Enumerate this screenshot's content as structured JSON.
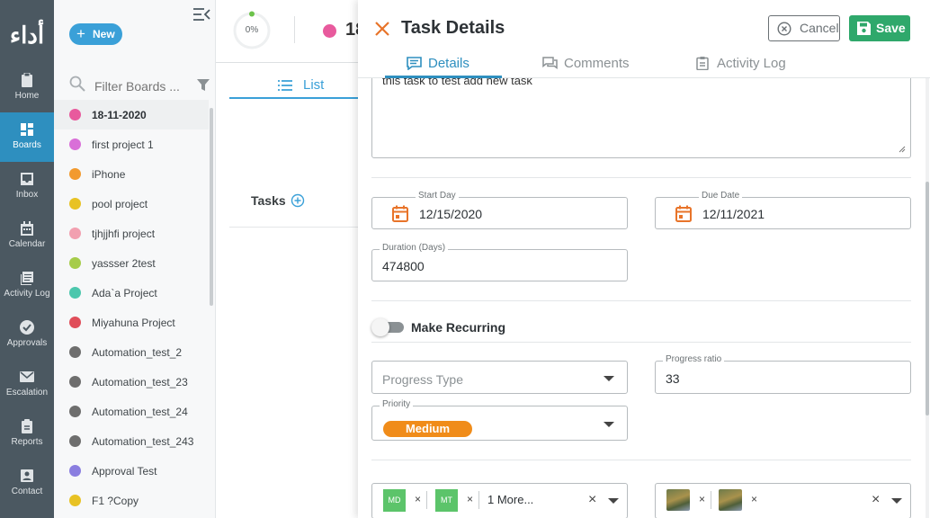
{
  "app": {
    "logo_text": "أداء"
  },
  "nav": {
    "items": [
      {
        "label": "Home",
        "icon": "clipboard-icon"
      },
      {
        "label": "Boards",
        "icon": "grid-icon"
      },
      {
        "label": "Inbox",
        "icon": "inbox-icon"
      },
      {
        "label": "Calendar",
        "icon": "calendar-icon"
      },
      {
        "label": "Activity Log",
        "icon": "log-icon"
      },
      {
        "label": "Approvals",
        "icon": "check-circle-icon"
      },
      {
        "label": "Escalation",
        "icon": "mail-icon"
      },
      {
        "label": "Reports",
        "icon": "report-icon"
      },
      {
        "label": "Contact",
        "icon": "contact-icon"
      }
    ],
    "active": "Boards"
  },
  "boards": {
    "new_label": "New",
    "filter_placeholder": "Filter Boards ...",
    "items": [
      {
        "name": "18-11-2020",
        "color": "#e85a9d"
      },
      {
        "name": "first project 1",
        "color": "#d96fd8"
      },
      {
        "name": "iPhone",
        "color": "#f29a2e"
      },
      {
        "name": "pool project",
        "color": "#e8c224"
      },
      {
        "name": "tjhjjhfi project",
        "color": "#f2a0b0"
      },
      {
        "name": "yassser 2test",
        "color": "#a6cc4a"
      },
      {
        "name": "Ada`a Project",
        "color": "#4cc7ad"
      },
      {
        "name": "Miyahuna Project",
        "color": "#e04e5a"
      },
      {
        "name": "Automation_test_2",
        "color": "#6e6e6e"
      },
      {
        "name": "Automation_test_23",
        "color": "#6e6e6e"
      },
      {
        "name": "Automation_test_24",
        "color": "#6e6e6e"
      },
      {
        "name": "Automation_test_243",
        "color": "#6e6e6e"
      },
      {
        "name": "Approval Test",
        "color": "#8a7ee0"
      },
      {
        "name": "F1 ?Copy",
        "color": "#e8c224"
      }
    ]
  },
  "board_view": {
    "progress": "0%",
    "title_partial": "18",
    "list_tab": "List",
    "tasks_label": "Tasks"
  },
  "task": {
    "title": "Task Details",
    "cancel_label": "Cancel",
    "save_label": "Save",
    "tabs": [
      "Details",
      "Comments",
      "Activity Log"
    ],
    "active_tab": "Details",
    "description": "this task to test add new task",
    "start_day_label": "Start Day",
    "start_day": "12/15/2020",
    "due_date_label": "Due Date",
    "due_date": "12/11/2021",
    "duration_label": "Duration (Days)",
    "duration": "474800",
    "recurring_label": "Make Recurring",
    "progress_type_placeholder": "Progress Type",
    "progress_ratio_label": "Progress ratio",
    "progress_ratio": "33",
    "priority_label": "Priority",
    "priority": "Medium",
    "assignees": [
      "MD",
      "MT"
    ],
    "assignees_more": "1 More...",
    "colors": {
      "accent": "#2e8fbf",
      "save": "#2fa86b",
      "medium": "#f08c1a",
      "close": "#e8742a",
      "avatar": "#5cc46a"
    }
  }
}
